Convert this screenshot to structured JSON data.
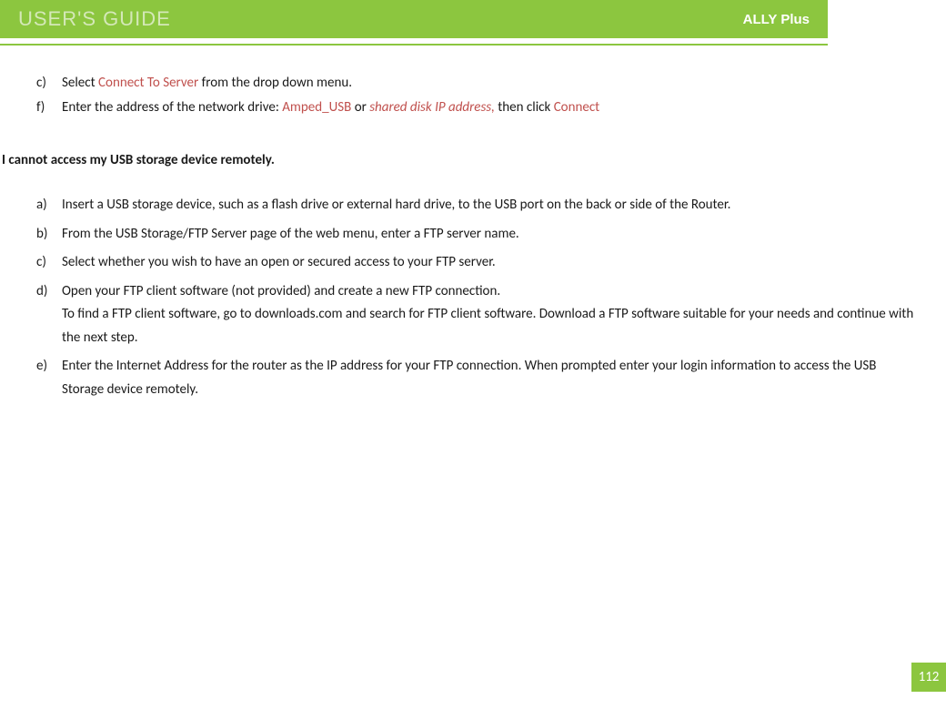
{
  "header": {
    "title": "USER'S GUIDE",
    "product": "ALLY Plus"
  },
  "topList": {
    "itemC": {
      "marker": "c)",
      "prefix": "Select ",
      "highlight": "Connect To Server",
      "suffix": " from the drop down menu."
    },
    "itemF": {
      "marker": "f)",
      "prefix": "Enter the address of the network drive: ",
      "highlight1": "Amped_USB ",
      "mid": "  or  ",
      "highlight2": "shared disk IP address,",
      "mid2": "  then click ",
      "highlight3": "Connect"
    }
  },
  "sectionHeading": "I cannot access my USB storage device remotely.",
  "secondList": {
    "a": {
      "marker": "a)",
      "text": "Insert a USB storage device, such as a flash drive or external hard drive, to the USB port on the back or side of the Router."
    },
    "b": {
      "marker": "b)",
      "text": "From the USB Storage/FTP Server page of the web menu, enter a FTP server name."
    },
    "c": {
      "marker": "c)",
      "text": "Select whether you wish to have an open or secured access to your FTP server."
    },
    "d": {
      "marker": "d)",
      "text": "Open your FTP client software (not provided) and create a new FTP connection.",
      "text2": "To find a FTP client software, go to downloads.com and search for FTP client software.  Download a FTP software suitable for your needs and continue with the next step."
    },
    "e": {
      "marker": "e)",
      "text": "Enter the Internet Address for the router as the IP address for your FTP connection.  When prompted enter your login information to access the USB Storage device remotely."
    }
  },
  "pageNumber": "112"
}
